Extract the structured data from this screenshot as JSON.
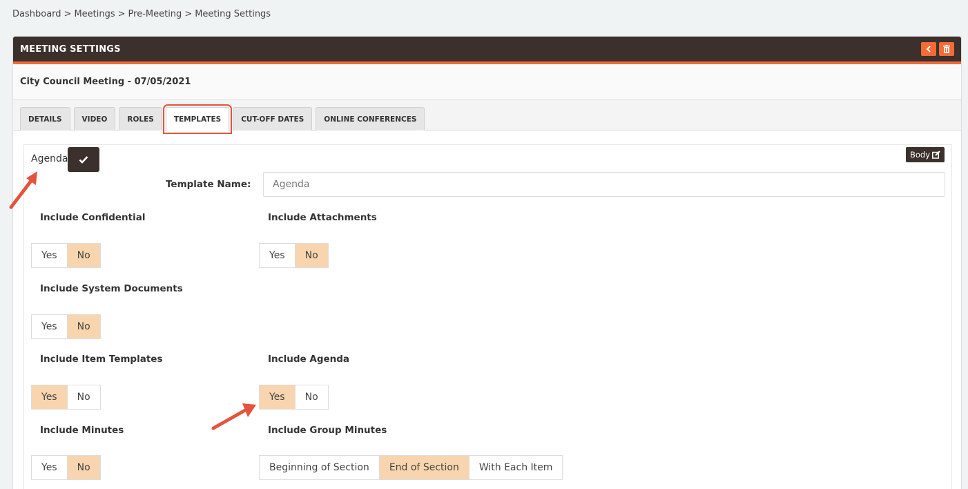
{
  "breadcrumb": [
    "Dashboard",
    ">",
    "Meetings",
    ">",
    "Pre-Meeting",
    ">",
    "Meeting Settings"
  ],
  "header": {
    "title": "MEETING SETTINGS",
    "back_icon": "chevron-left-icon",
    "delete_icon": "trash-icon"
  },
  "meeting": {
    "name": "City Council Meeting - 07/05/2021"
  },
  "tabs": [
    {
      "label": "DETAILS"
    },
    {
      "label": "VIDEO"
    },
    {
      "label": "ROLES"
    },
    {
      "label": "TEMPLATES",
      "active": true
    },
    {
      "label": "CUT-OFF DATES"
    },
    {
      "label": "ONLINE CONFERENCES"
    }
  ],
  "template": {
    "section_label": "Agenda",
    "body_button": "Body",
    "name_label": "Template Name:",
    "name_placeholder": "Agenda"
  },
  "fields": {
    "confidential": {
      "label": "Include Confidential",
      "yes": "Yes",
      "no": "No",
      "selected": "No"
    },
    "attachments": {
      "label": "Include Attachments",
      "yes": "Yes",
      "no": "No",
      "selected": "No"
    },
    "system_documents": {
      "label": "Include System Documents",
      "yes": "Yes",
      "no": "No",
      "selected": "No"
    },
    "item_templates": {
      "label": "Include Item Templates",
      "yes": "Yes",
      "no": "No",
      "selected": "Yes"
    },
    "agenda": {
      "label": "Include Agenda",
      "yes": "Yes",
      "no": "No",
      "selected": "Yes"
    },
    "minutes": {
      "label": "Include Minutes",
      "yes": "Yes",
      "no": "No",
      "selected": "No"
    },
    "group_minutes": {
      "label": "Include Group Minutes",
      "options": [
        "Beginning of Section",
        "End of Section",
        "With Each Item"
      ],
      "selected": "End of Section"
    }
  },
  "colors": {
    "header_bg": "#3b302c",
    "accent": "#f36b36",
    "selected_bg": "#f8d5ae",
    "highlight": "#e5533d"
  }
}
